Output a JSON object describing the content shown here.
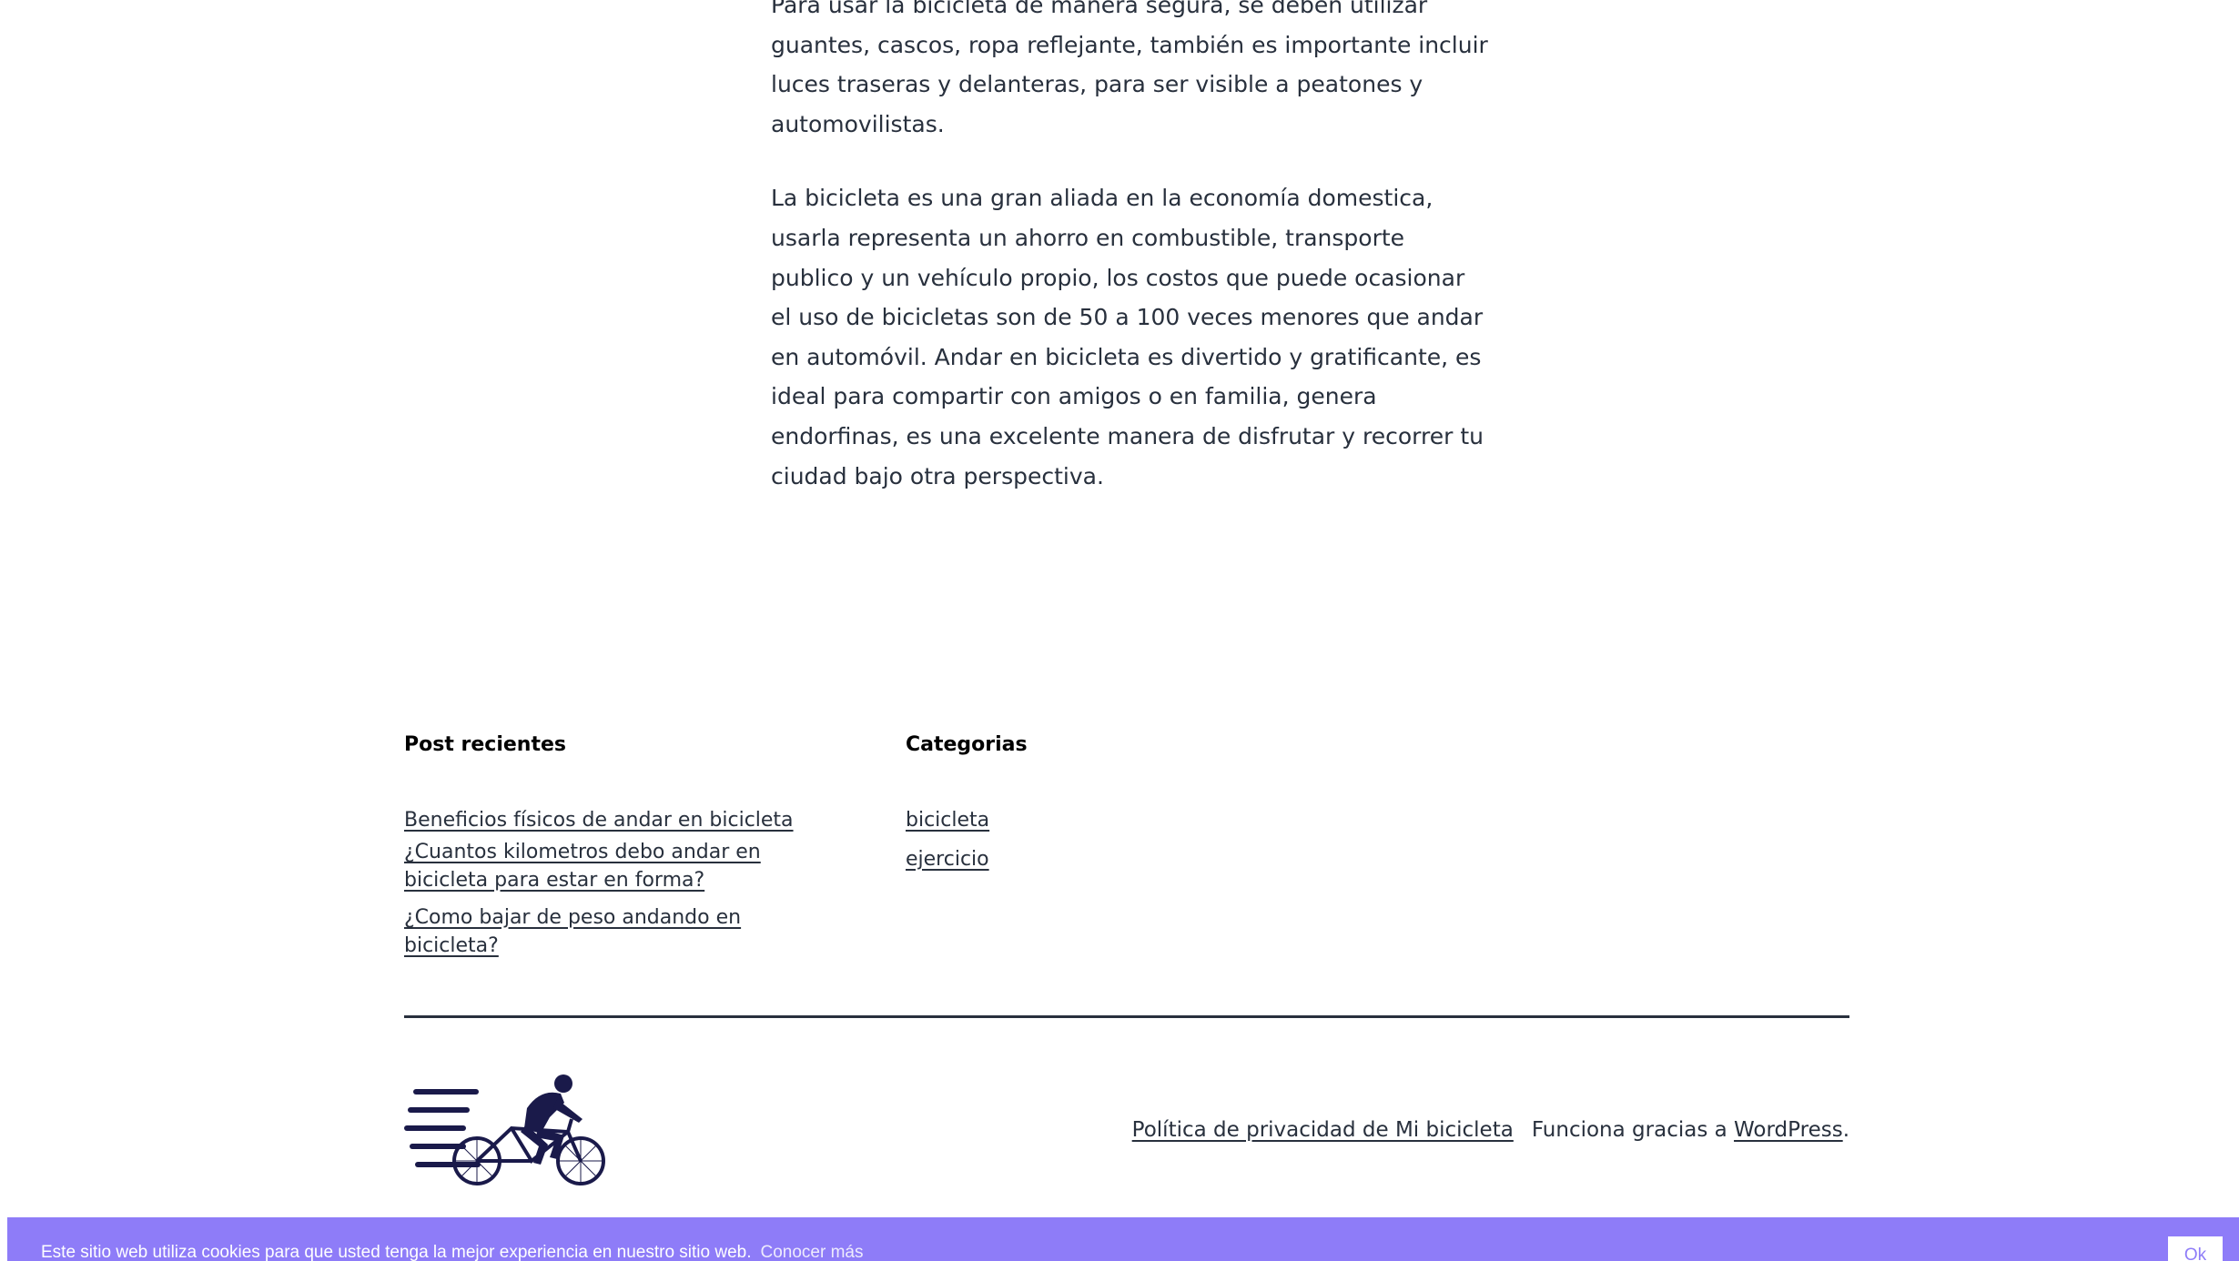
{
  "article": {
    "paragraphs": [
      "Para usar la bicicleta de manera segura, se deben utilizar guantes, cascos, ropa reflejante, también es importante incluir luces traseras y delanteras, para ser visible a peatones y automovilistas.",
      "La bicicleta es una gran aliada en la economía domestica, usarla representa un ahorro en combustible, transporte publico y un vehículo propio, los costos que puede ocasionar el uso de bicicletas son de 50 a 100 veces menores que andar en automóvil. Andar en bicicleta es divertido y gratificante, es ideal para compartir con amigos o en familia, genera endorfinas, es una excelente manera de disfrutar y recorrer tu ciudad bajo otra perspectiva."
    ]
  },
  "widgets": {
    "recent_posts": {
      "title": "Post recientes",
      "items": [
        "Beneficios físicos de andar en bicicleta",
        "¿Cuantos kilometros debo andar en bicicleta para estar en forma?",
        "¿Como bajar de peso andando en bicicleta?"
      ]
    },
    "categories": {
      "title": "Categorias",
      "items": [
        "bicicleta",
        "ejercicio"
      ]
    }
  },
  "footer": {
    "logo_icon": "cyclist-logo-icon",
    "privacy_link": "Política de privacidad de Mi bicicleta",
    "powered_prefix": "Funciona gracias a ",
    "powered_link": "WordPress",
    "powered_suffix": "."
  },
  "cookie_bar": {
    "message": "Este sitio web utiliza cookies para que usted tenga la mejor experiencia en nuestro sitio web.",
    "more_link": "Conocer más",
    "ok_button": "Ok",
    "background": "#8e7cf8"
  },
  "colors": {
    "text": "#28303d",
    "logo": "#1a1a4a"
  }
}
